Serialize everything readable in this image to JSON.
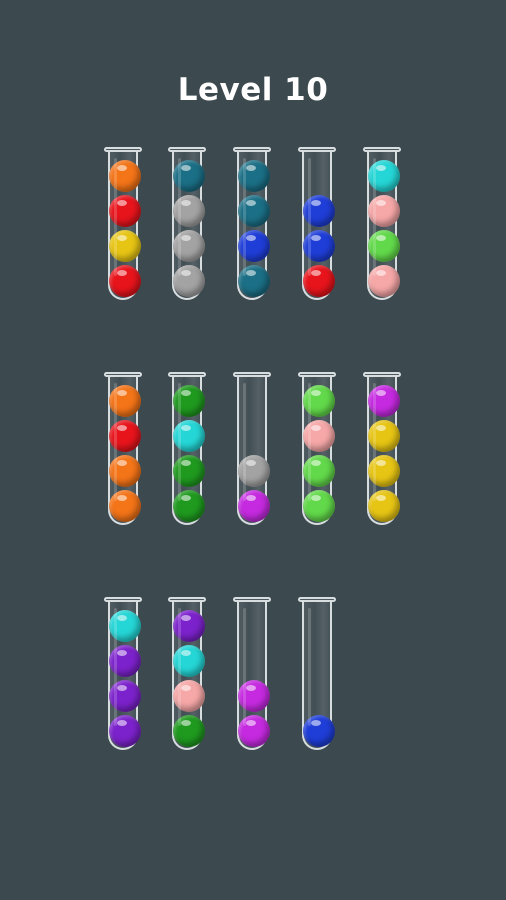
{
  "level_title": "Level 10",
  "tubes": [
    {
      "balls": [
        "red",
        "yellow",
        "red",
        "orange"
      ]
    },
    {
      "balls": [
        "gray",
        "gray",
        "gray",
        "teal"
      ]
    },
    {
      "balls": [
        "teal",
        "blue",
        "teal",
        "teal"
      ]
    },
    {
      "balls": [
        "red",
        "blue",
        "blue"
      ]
    },
    {
      "balls": [
        "pink",
        "green",
        "pink",
        "cyan"
      ]
    },
    {
      "balls": [
        "orange",
        "orange",
        "red",
        "orange"
      ]
    },
    {
      "balls": [
        "darkgreen",
        "darkgreen",
        "cyan",
        "darkgreen"
      ]
    },
    {
      "balls": [
        "magenta",
        "gray"
      ]
    },
    {
      "balls": [
        "green",
        "green",
        "pink",
        "green"
      ]
    },
    {
      "balls": [
        "yellow",
        "yellow",
        "yellow",
        "magenta"
      ]
    },
    {
      "balls": [
        "purple",
        "purple",
        "purple",
        "cyan"
      ]
    },
    {
      "balls": [
        "darkgreen",
        "pink",
        "cyan",
        "purple"
      ]
    },
    {
      "balls": [
        "magenta",
        "magenta"
      ]
    },
    {
      "balls": [
        "blue"
      ]
    }
  ],
  "colors": {
    "red": "#e8141c",
    "orange": "#f47418",
    "yellow": "#e7c514",
    "teal": "#1b6f86",
    "gray": "#a3a3a3",
    "blue": "#1f3ed8",
    "cyan": "#25d6d6",
    "pink": "#f6a7a7",
    "green": "#62d94a",
    "darkgreen": "#1f9a1f",
    "magenta": "#c52ae0",
    "purple": "#7c22cc"
  }
}
